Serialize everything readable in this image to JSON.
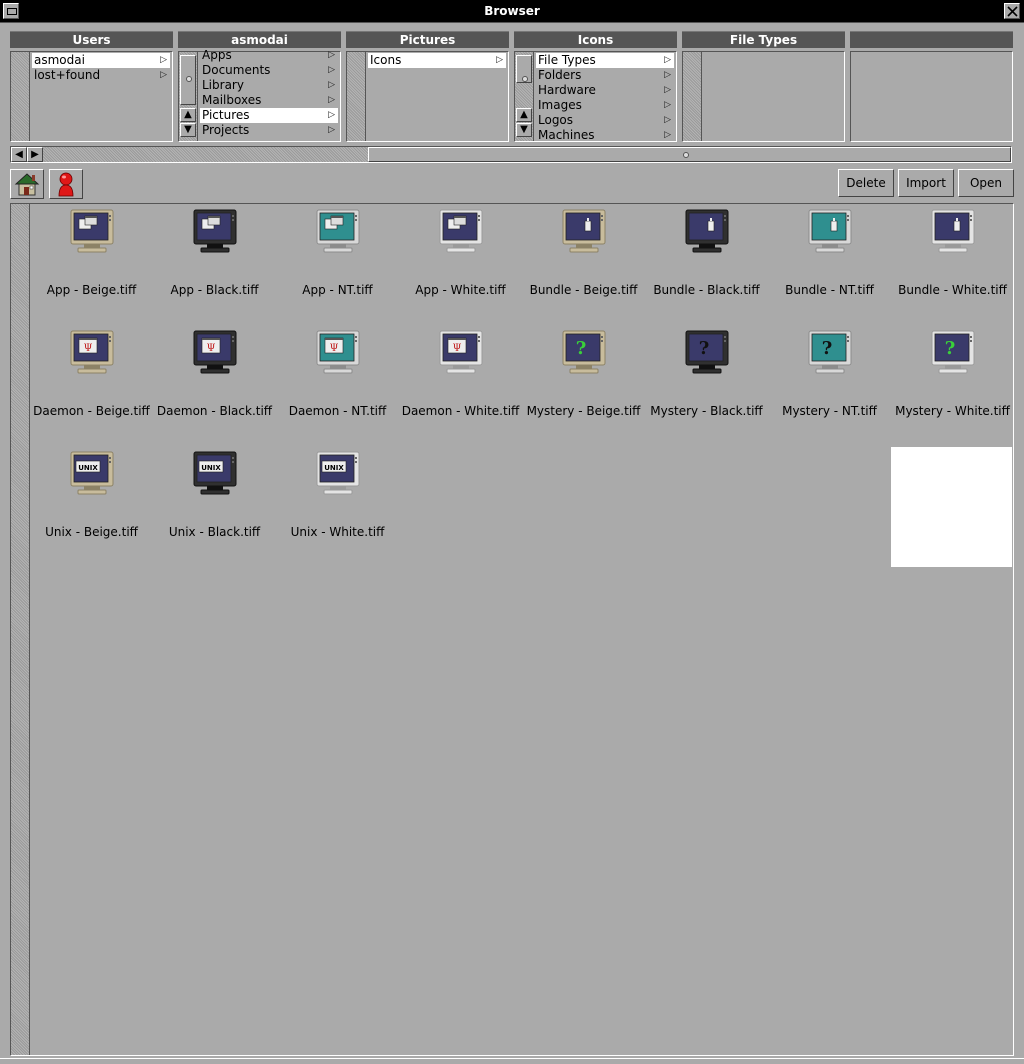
{
  "window": {
    "title": "Browser"
  },
  "columns": [
    {
      "header": "Users",
      "items": [
        {
          "label": "asmodai",
          "selected": true,
          "has_children": true
        },
        {
          "label": "lost+found",
          "selected": false,
          "has_children": true
        }
      ]
    },
    {
      "header": "asmodai",
      "items": [
        {
          "label": "Apps",
          "selected": false,
          "has_children": true
        },
        {
          "label": "Documents",
          "selected": false,
          "has_children": true
        },
        {
          "label": "Library",
          "selected": false,
          "has_children": true
        },
        {
          "label": "Mailboxes",
          "selected": false,
          "has_children": true
        },
        {
          "label": "Pictures",
          "selected": true,
          "has_children": true
        },
        {
          "label": "Projects",
          "selected": false,
          "has_children": true
        }
      ]
    },
    {
      "header": "Pictures",
      "items": [
        {
          "label": "Icons",
          "selected": true,
          "has_children": true
        }
      ]
    },
    {
      "header": "Icons",
      "items": [
        {
          "label": "File Types",
          "selected": true,
          "has_children": true
        },
        {
          "label": "Folders",
          "selected": false,
          "has_children": true
        },
        {
          "label": "Hardware",
          "selected": false,
          "has_children": true
        },
        {
          "label": "Images",
          "selected": false,
          "has_children": true
        },
        {
          "label": "Logos",
          "selected": false,
          "has_children": true
        },
        {
          "label": "Machines",
          "selected": false,
          "has_children": true
        }
      ]
    },
    {
      "header": "File Types",
      "items": []
    },
    {
      "header": "",
      "items": []
    }
  ],
  "toolbar": {
    "home_icon": "home-icon",
    "user_icon": "user-icon",
    "delete_label": "Delete",
    "import_label": "Import",
    "open_label": "Open"
  },
  "files": [
    {
      "label": "App - Beige.tiff",
      "kind": "app",
      "skin": "beige"
    },
    {
      "label": "App - Black.tiff",
      "kind": "app",
      "skin": "black"
    },
    {
      "label": "App - NT.tiff",
      "kind": "app",
      "skin": "nt"
    },
    {
      "label": "App - White.tiff",
      "kind": "app",
      "skin": "white"
    },
    {
      "label": "Bundle - Beige.tiff",
      "kind": "bundle",
      "skin": "beige"
    },
    {
      "label": "Bundle - Black.tiff",
      "kind": "bundle",
      "skin": "black"
    },
    {
      "label": "Bundle - NT.tiff",
      "kind": "bundle",
      "skin": "nt"
    },
    {
      "label": "Bundle - White.tiff",
      "kind": "bundle",
      "skin": "white"
    },
    {
      "label": "Daemon - Beige.tiff",
      "kind": "daemon",
      "skin": "beige"
    },
    {
      "label": "Daemon - Black.tiff",
      "kind": "daemon",
      "skin": "black"
    },
    {
      "label": "Daemon - NT.tiff",
      "kind": "daemon",
      "skin": "nt"
    },
    {
      "label": "Daemon - White.tiff",
      "kind": "daemon",
      "skin": "white"
    },
    {
      "label": "Mystery - Beige.tiff",
      "kind": "mystery",
      "skin": "beige"
    },
    {
      "label": "Mystery - Black.tiff",
      "kind": "mystery",
      "skin": "black"
    },
    {
      "label": "Mystery - NT.tiff",
      "kind": "mystery",
      "skin": "nt"
    },
    {
      "label": "Mystery - White.tiff",
      "kind": "mystery",
      "skin": "white"
    },
    {
      "label": "Unix - Beige.tiff",
      "kind": "unix",
      "skin": "beige"
    },
    {
      "label": "Unix - Black.tiff",
      "kind": "unix",
      "skin": "black"
    },
    {
      "label": "Unix - White.tiff",
      "kind": "unix",
      "skin": "white"
    }
  ],
  "colors": {
    "skins": {
      "beige": {
        "bezel": "#c8bc9c",
        "bezel_dark": "#8c8266",
        "screen": "#3a3a6a"
      },
      "black": {
        "bezel": "#303030",
        "bezel_dark": "#111111",
        "screen": "#3a3a6a"
      },
      "nt": {
        "bezel": "#d8d8d8",
        "bezel_dark": "#8c8c8c",
        "screen": "#2f8f8f"
      },
      "white": {
        "bezel": "#e4e4e4",
        "bezel_dark": "#9a9a9a",
        "screen": "#3a3a6a"
      }
    }
  }
}
